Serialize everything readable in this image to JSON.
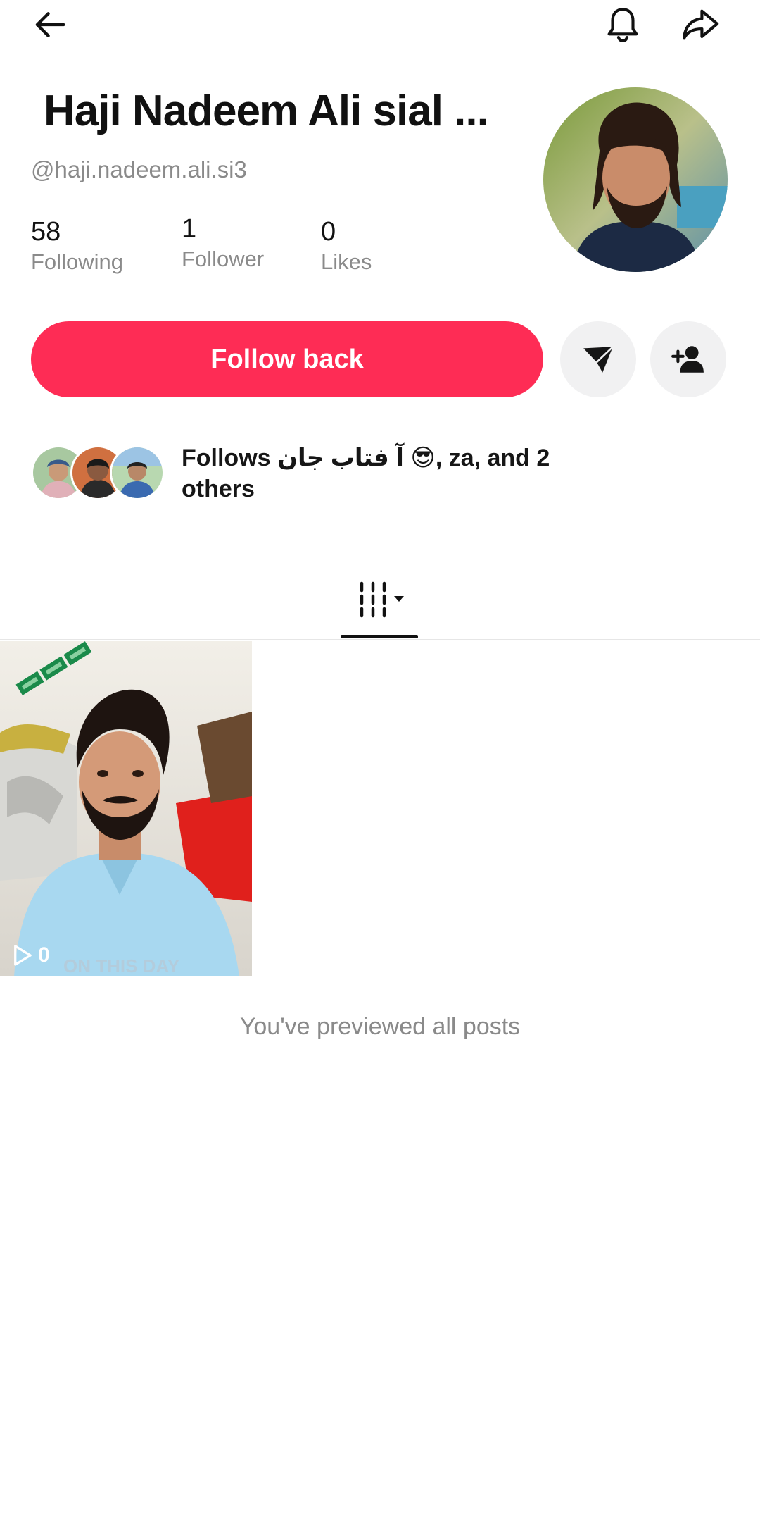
{
  "top_bar": {
    "back_icon": "arrow-left-icon",
    "bell_icon": "bell-icon",
    "share_icon": "share-arrow-icon"
  },
  "profile": {
    "name": "Haji Nadeem Ali sial ...",
    "handle": "@haji.nadeem.ali.si3",
    "stats": [
      {
        "value": "58",
        "label": "Following"
      },
      {
        "value": "1",
        "label": "Follower"
      },
      {
        "value": "0",
        "label": "Likes"
      }
    ]
  },
  "actions": {
    "follow_label": "Follow back",
    "follow_color": "#fe2c55",
    "message_icon": "send-icon",
    "add_friend_icon": "add-user-icon"
  },
  "mutual": {
    "text": "Follows آ فتاب جان 😎, za, and 2 others"
  },
  "tabs": {
    "active_icon": "grid-icon",
    "dropdown_icon": "caret-down-icon"
  },
  "posts": [
    {
      "views": "0",
      "play_icon": "play-icon"
    }
  ],
  "footer": {
    "end_text": "You've previewed all posts"
  }
}
